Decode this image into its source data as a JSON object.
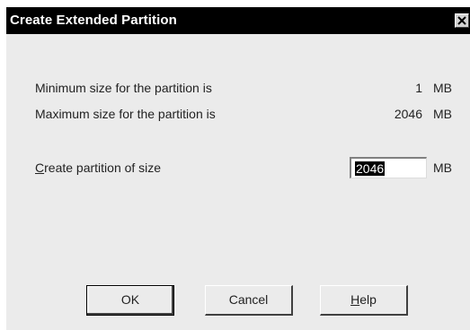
{
  "dialog": {
    "title": "Create Extended Partition",
    "close_symbol": "×",
    "min_label": "Minimum size for the partition is",
    "min_value": "1",
    "min_unit": "MB",
    "max_label": "Maximum size for the partition is",
    "max_value": "2046",
    "max_unit": "MB",
    "size_label_mnemonic": "C",
    "size_label_rest": "reate partition of size",
    "size_input_value": "2046",
    "size_unit": "MB",
    "ok_label": "OK",
    "cancel_label": "Cancel",
    "help_mnemonic": "H",
    "help_rest": "elp"
  }
}
